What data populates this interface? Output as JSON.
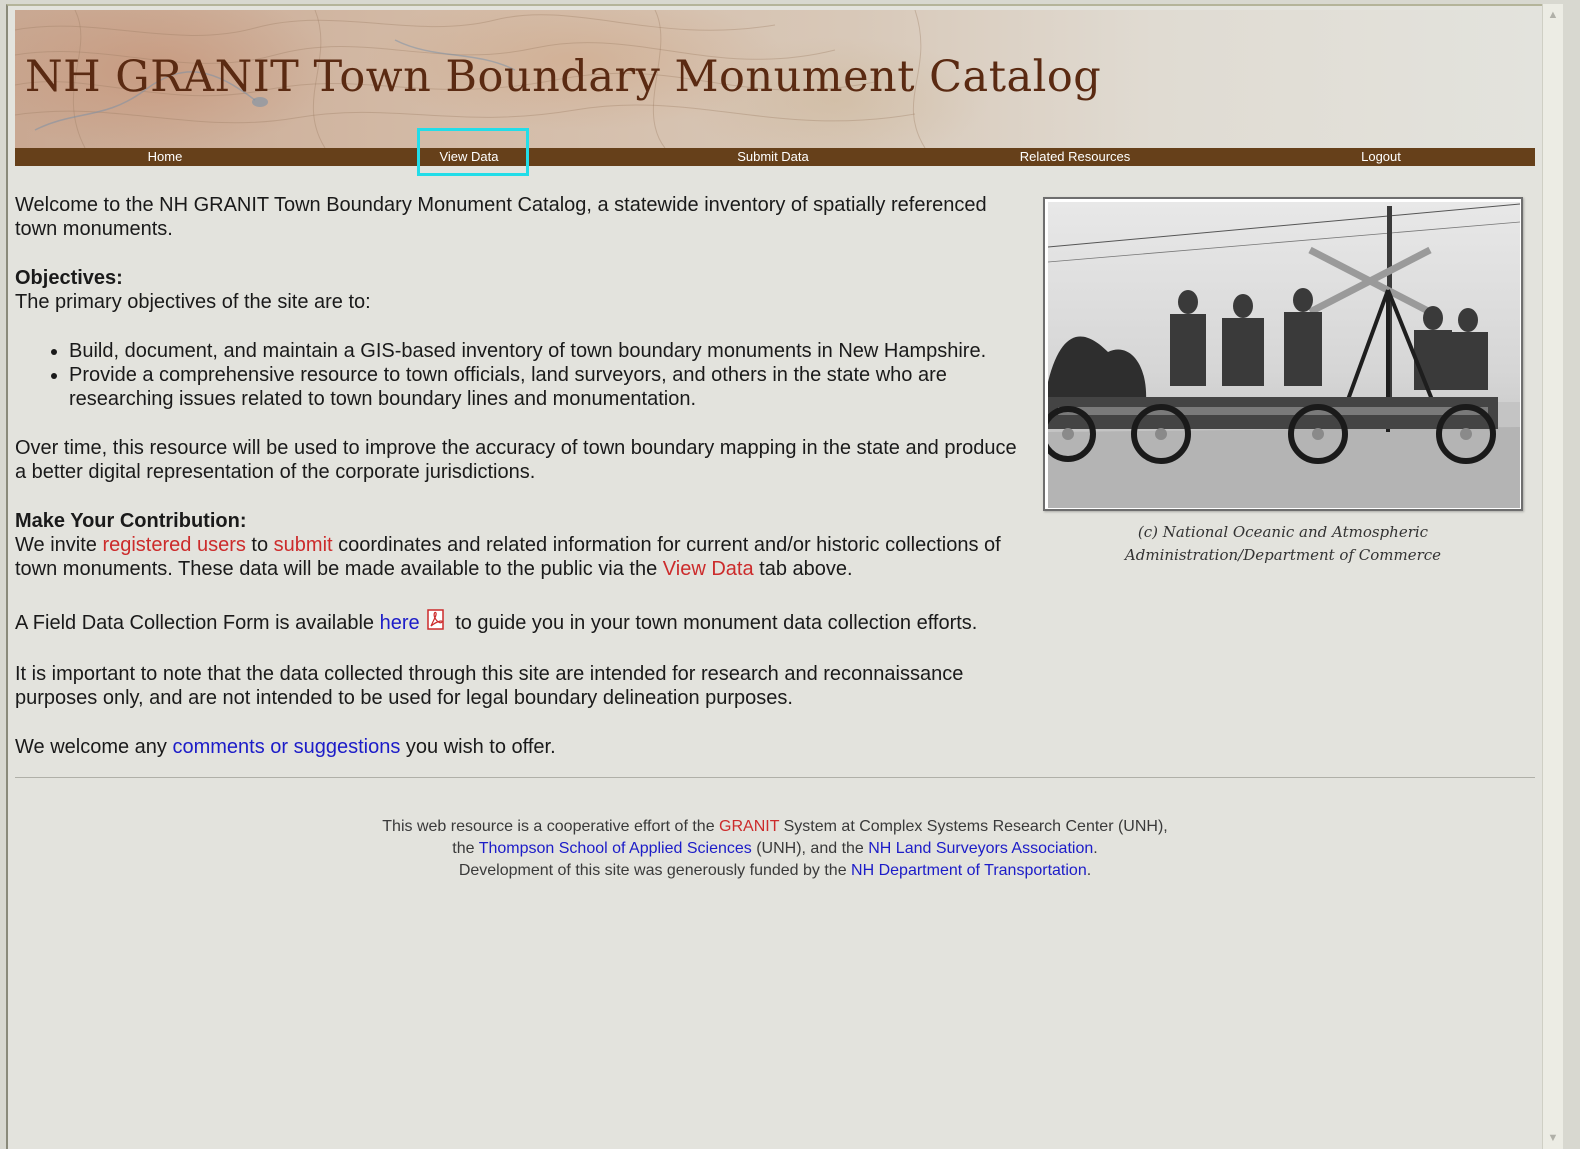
{
  "header": {
    "title": "NH GRANIT Town Boundary Monument Catalog"
  },
  "nav": {
    "items": [
      {
        "label": "Home"
      },
      {
        "label": "View Data"
      },
      {
        "label": "Submit Data"
      },
      {
        "label": "Related Resources"
      },
      {
        "label": "Logout"
      }
    ],
    "highlighted": "View Data",
    "highlight_color": "#22dde8"
  },
  "main": {
    "welcome": "Welcome to the NH GRANIT Town Boundary Monument Catalog, a statewide inventory of spatially referenced town monuments.",
    "objectives_heading": "Objectives:",
    "objectives_intro": "The primary objectives of the site are to:",
    "objectives": [
      "Build, document, and maintain a GIS-based inventory of town boundary monuments in New Hampshire.",
      "Provide a comprehensive resource to town officials, land surveyors, and others in the state who are researching issues related to town boundary lines and monumentation."
    ],
    "over_time": "Over time, this resource will be used to improve the accuracy of town boundary mapping in the state and produce a better digital representation of the corporate jurisdictions.",
    "contribution_heading": "Make Your Contribution:",
    "contribution": {
      "text1": "We invite ",
      "link_registered": "registered users",
      "text2": " to ",
      "link_submit": "submit",
      "text3": " coordinates and related information for current and/or historic collections of town monuments. These data will be made available to the public via the ",
      "link_view": "View Data",
      "text4": " tab above."
    },
    "form": {
      "text1": "A Field Data Collection Form is available ",
      "link_here": "here",
      "text2": " to guide you in your town monument data collection efforts.",
      "icon": "pdf-icon"
    },
    "note": "It is important to note that the data collected through this site are intended for research and reconnaissance purposes only, and are not intended to be used for legal boundary delineation purposes.",
    "welcome_comments": {
      "text1": "We welcome any ",
      "link_comments": "comments or suggestions",
      "text2": " you wish to offer."
    }
  },
  "photo": {
    "caption_line1": "(c) National Oceanic and Atmospheric",
    "caption_line2": "Administration/Department of Commerce"
  },
  "footer": {
    "line1_a": "This web resource is a cooperative effort of the ",
    "link_granit": "GRANIT",
    "line1_b": " System at Complex Systems Research Center (UNH),",
    "line2_a": "the ",
    "link_thompson": "Thompson School of Applied Sciences",
    "line2_b": " (UNH), and the ",
    "link_nhlsa": "NH Land Surveyors Association",
    "line2_c": ".",
    "line3_a": "Development of this site was generously funded by the ",
    "link_nhdot": "NH Department of Transportation",
    "line3_b": "."
  },
  "colors": {
    "nav_bg": "#66401a",
    "title": "#5a2a12",
    "link_red": "#cc2b2b",
    "link_blue": "#1c1cc8"
  }
}
